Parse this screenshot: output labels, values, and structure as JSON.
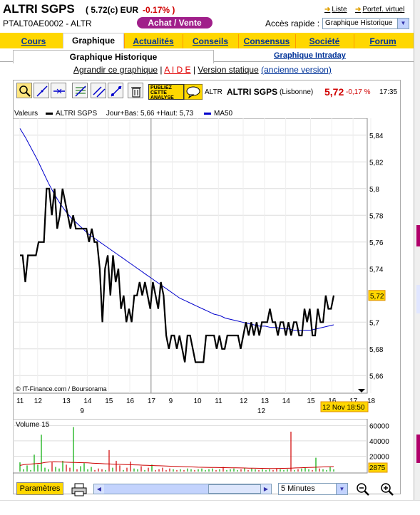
{
  "header": {
    "title": "ALTRI SGPS",
    "price": "( 5.72(c) EUR",
    "change": "-0.17% )",
    "isin": "PTALT0AE0002 - ALTR",
    "achat_label": "Achat / Vente",
    "acces_label": "Accès rapide :",
    "acces_value": "Graphique Historique",
    "liste_label": "Liste",
    "portef_label": "Portef. virtuel"
  },
  "tabs": [
    "Cours",
    "Graphique",
    "Actualités",
    "Conseils",
    "Consensus",
    "Société",
    "Forum"
  ],
  "active_tab": "Graphique",
  "subtabs": {
    "active": "Graphique Historique",
    "other": "Graphique Intraday"
  },
  "links": {
    "agrandir": "Agrandir ce graphique",
    "sep1": " | ",
    "aide": "A I D E",
    "sep2": " | ",
    "version": "Version statique",
    "ancienne": "(ancienne version)"
  },
  "chart_header": {
    "publiez": [
      "PUBLIEZ",
      "CETTE",
      "ANALYSE"
    ],
    "symbol": "ALTR",
    "name": "ALTRI SGPS",
    "exchange": "(Lisbonne)",
    "price": "5,72",
    "change": "-0,17 %",
    "time": "17:35"
  },
  "legend": {
    "valeurs": "Valeurs",
    "series1": "ALTRI SGPS",
    "stats": "Jour+Bas: 5,66 +Haut: 5,73",
    "series2": "MA50"
  },
  "credit": "© IT-Finance.com / Boursorama",
  "volume_label": "Volume 15",
  "volume_last": "2875",
  "price_last_tag": "5,72",
  "date_tag": "12 Nov 18:50",
  "params_button": "Paramètres",
  "interval": "5 Minutes",
  "colors": {
    "accent": "#ffd700",
    "price_line": "#000000",
    "ma_line": "#0000cc",
    "down": "#d00000",
    "up": "#00aa00",
    "achat": "#a01f8a"
  },
  "chart_data": {
    "type": "line",
    "title": "",
    "xlabel": "",
    "ylabel": "",
    "ylim": [
      5.65,
      5.85
    ],
    "yticks": [
      "5,84",
      "5,82",
      "5,8",
      "5,78",
      "5,76",
      "5,74",
      "5,72",
      "5,7",
      "5,68",
      "5,66"
    ],
    "xticks": [
      {
        "label": "11",
        "t": 0.02
      },
      {
        "label": "12",
        "t": 0.07
      },
      {
        "label": "13",
        "t": 0.15
      },
      {
        "label": "14",
        "t": 0.21
      },
      {
        "label": "15",
        "t": 0.27
      },
      {
        "label": "16",
        "t": 0.33
      },
      {
        "label": "17",
        "t": 0.39
      },
      {
        "label": "9",
        "t": 0.45
      },
      {
        "label": "10",
        "t": 0.52
      },
      {
        "label": "11",
        "t": 0.58
      },
      {
        "label": "12",
        "t": 0.65
      },
      {
        "label": "13",
        "t": 0.71
      },
      {
        "label": "14",
        "t": 0.77
      },
      {
        "label": "15",
        "t": 0.84
      },
      {
        "label": "16",
        "t": 0.9
      },
      {
        "label": "17",
        "t": 0.96
      },
      {
        "label": "18",
        "t": 1.01
      }
    ],
    "day_labels": [
      {
        "label": "9",
        "t": 0.2
      },
      {
        "label": "12",
        "t": 0.7
      }
    ],
    "session_divider_t": 0.39,
    "series": [
      {
        "name": "ALTRI SGPS",
        "color": "#000000",
        "values": [
          5.75,
          5.75,
          5.73,
          5.75,
          5.75,
          5.75,
          5.75,
          5.76,
          5.76,
          5.76,
          5.8,
          5.8,
          5.78,
          5.8,
          5.77,
          5.78,
          5.8,
          5.79,
          5.78,
          5.77,
          5.78,
          5.77,
          5.77,
          5.77,
          5.77,
          5.77,
          5.76,
          5.77,
          5.76,
          5.76,
          5.74,
          5.7,
          5.74,
          5.75,
          5.72,
          5.75,
          5.73,
          5.74,
          5.71,
          5.72,
          5.7,
          5.71,
          5.7,
          5.72,
          5.72,
          5.73,
          5.72,
          5.73,
          5.72,
          5.71,
          5.73,
          5.72,
          5.71,
          5.73,
          5.72,
          5.69,
          5.68,
          5.69,
          5.69,
          5.68,
          5.69,
          5.68,
          5.67,
          5.69,
          5.69,
          5.68,
          5.67,
          5.67,
          5.67,
          5.67,
          5.69,
          5.69,
          5.69,
          5.69,
          5.68,
          5.69,
          5.68,
          5.68,
          5.69,
          5.69,
          5.69,
          5.69,
          5.69,
          5.68,
          5.69,
          5.7,
          5.69,
          5.7,
          5.69,
          5.7,
          5.69,
          5.7,
          5.7,
          5.7,
          5.71,
          5.7,
          5.7,
          5.69,
          5.7,
          5.7,
          5.69,
          5.7,
          5.69,
          5.7,
          5.7,
          5.69,
          5.69,
          5.71,
          5.7,
          5.71,
          5.69,
          5.69,
          5.71,
          5.7,
          5.7,
          5.72,
          5.71,
          5.71,
          5.72
        ]
      },
      {
        "name": "MA50",
        "color": "#0000cc",
        "values": [
          5.845,
          5.838,
          5.83,
          5.822,
          5.813,
          5.804,
          5.796,
          5.789,
          5.783,
          5.778,
          5.774,
          5.77,
          5.766,
          5.763,
          5.76,
          5.757,
          5.754,
          5.751,
          5.748,
          5.745,
          5.742,
          5.739,
          5.736,
          5.733,
          5.73,
          5.727,
          5.724,
          5.721,
          5.718,
          5.716,
          5.714,
          5.712,
          5.71,
          5.708,
          5.706,
          5.705,
          5.703,
          5.702,
          5.701,
          5.7,
          5.699,
          5.698,
          5.697,
          5.697,
          5.696,
          5.696,
          5.695,
          5.695,
          5.694,
          5.694,
          5.694,
          5.694,
          5.695,
          5.696,
          5.697,
          5.698
        ]
      }
    ],
    "volume": {
      "ylim": [
        0,
        65000
      ],
      "yticks": [
        "60000",
        "40000",
        "20000"
      ],
      "values": [
        12000,
        3000,
        8000,
        2000,
        22000,
        9000,
        48000,
        5000,
        3000,
        12000,
        6000,
        4000,
        14000,
        9000,
        5000,
        58000,
        3000,
        7000,
        11000,
        3000,
        6000,
        2000,
        4000,
        3000,
        2000,
        28000,
        5000,
        14000,
        8000,
        2000,
        5000,
        13000,
        4000,
        3000,
        7000,
        2000,
        5000,
        9000,
        2000,
        3000,
        5000,
        2000,
        4000,
        3000,
        2000,
        3000,
        2000,
        4000,
        3000,
        2000,
        3000,
        4000,
        2000,
        3000,
        4000,
        2000,
        3000,
        6000,
        2000,
        3000,
        4000,
        2000,
        3000,
        5000,
        2000,
        4000,
        3000,
        2000,
        3000,
        2000,
        3000,
        2000,
        4000,
        3000,
        2000,
        3000,
        52000,
        2000,
        3000,
        4000,
        5000,
        3000,
        2000,
        18000,
        4000,
        3000,
        2000,
        6000,
        2875
      ],
      "ma_values": [
        8000,
        9000,
        9500,
        10000,
        10500,
        11000,
        12000,
        12500,
        12800,
        12600,
        12400,
        12200,
        12000,
        11800,
        11600,
        11500,
        11300,
        11000,
        10700,
        10400,
        10100,
        9900,
        9700,
        9500,
        9300,
        9100,
        8900,
        8700,
        8500,
        8300,
        8100,
        7900,
        7700,
        7500,
        7300,
        7100,
        6900,
        6700,
        6500,
        6300,
        6100,
        5900,
        5700,
        5600,
        5500,
        5400,
        5300,
        5200,
        5100,
        5000,
        4900,
        4800,
        4700,
        4600,
        4500,
        4400,
        4300,
        4200,
        4100,
        4000,
        4000,
        4100,
        4200,
        4300,
        4500,
        4700,
        4900,
        5100,
        5300,
        5500,
        5700,
        5900,
        6100,
        6300,
        6500
      ]
    }
  }
}
